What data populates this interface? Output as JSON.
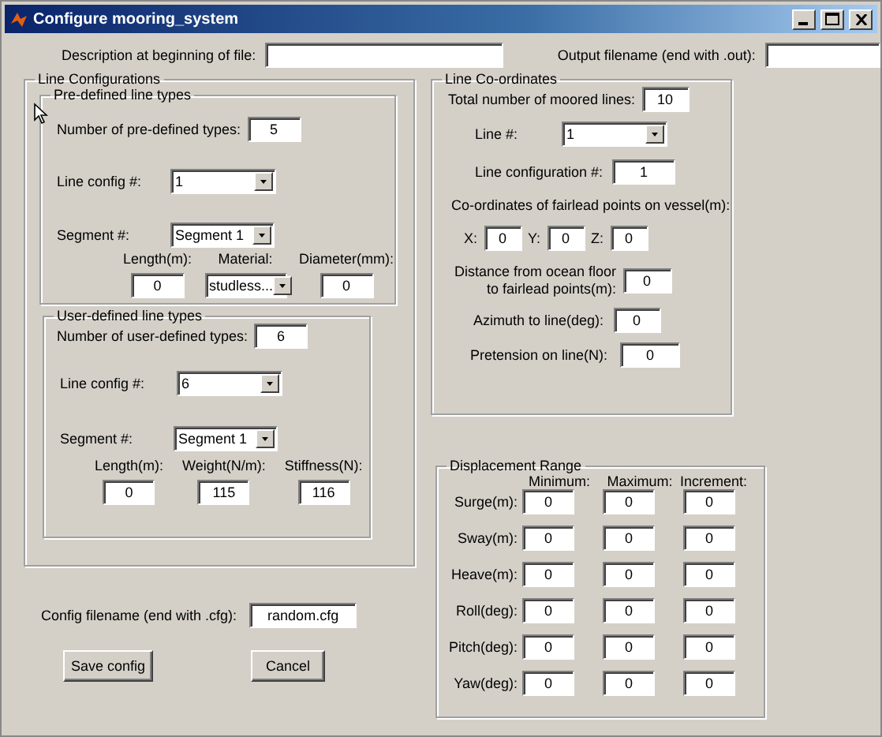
{
  "window": {
    "title": "Configure mooring_system"
  },
  "top_fields": [
    {
      "label": "Description at beginning of file:"
    },
    {
      "label": "Output filename (end with .out):"
    }
  ],
  "line_configurations": {
    "title": "Line Configurations",
    "predefined": {
      "title": "Pre-defined line types",
      "count_label": "Number of pre-defined types:",
      "count_value": "5",
      "config_label": "Line config #:",
      "config_value": "1",
      "segment_label": "Segment #:",
      "segment_value": "Segment 1",
      "props": [
        {
          "label": "Length(m):",
          "value": "0",
          "kind": "text"
        },
        {
          "label": "Material:",
          "value": "studless...",
          "kind": "dropdown"
        },
        {
          "label": "Diameter(mm):",
          "value": "0",
          "kind": "text"
        }
      ]
    },
    "user_defined": {
      "title": "User-defined line types",
      "count_label": "Number of user-defined types:",
      "count_value": "6",
      "config_label": "Line config #:",
      "config_value": "6",
      "segment_label": "Segment #:",
      "segment_value": "Segment 1",
      "props": [
        {
          "label": "Length(m):",
          "value": "0",
          "kind": "text"
        },
        {
          "label": "Weight(N/m):",
          "value": "115",
          "kind": "text"
        },
        {
          "label": "Stiffness(N):",
          "value": "116",
          "kind": "text"
        }
      ]
    }
  },
  "config_filename": {
    "label": "Config filename (end with .cfg):",
    "value": "random.cfg"
  },
  "buttons": [
    "Save config",
    "Cancel"
  ],
  "line_coordinates": {
    "title": "Line Co-ordinates",
    "total_label": "Total number of moored lines:",
    "total_value": "10",
    "line_label": "Line #:",
    "line_value": "1",
    "config_label": "Line configuration #:",
    "config_value": "1",
    "coords_label": "Co-ordinates of fairlead points on vessel(m):",
    "coords": [
      {
        "label": "X:",
        "value": "0"
      },
      {
        "label": "Y:",
        "value": "0"
      },
      {
        "label": "Z:",
        "value": "0"
      }
    ],
    "distance_label": [
      "Distance from ocean floor",
      "to fairlead points(m):"
    ],
    "distance_value": "0",
    "azimuth_label": "Azimuth to line(deg):",
    "azimuth_value": "0",
    "pretension_label": "Pretension on line(N):",
    "pretension_value": "0"
  },
  "displacement": {
    "title": "Displacement Range",
    "columns": [
      "Minimum:",
      "Maximum:",
      "Increment:"
    ],
    "rows": [
      {
        "label": "Surge(m):",
        "values": [
          "0",
          "0",
          "0"
        ]
      },
      {
        "label": "Sway(m):",
        "values": [
          "0",
          "0",
          "0"
        ]
      },
      {
        "label": "Heave(m):",
        "values": [
          "0",
          "0",
          "0"
        ]
      },
      {
        "label": "Roll(deg):",
        "values": [
          "0",
          "0",
          "0"
        ]
      },
      {
        "label": "Pitch(deg):",
        "values": [
          "0",
          "0",
          "0"
        ]
      },
      {
        "label": "Yaw(deg):",
        "values": [
          "0",
          "0",
          "0"
        ]
      }
    ]
  }
}
